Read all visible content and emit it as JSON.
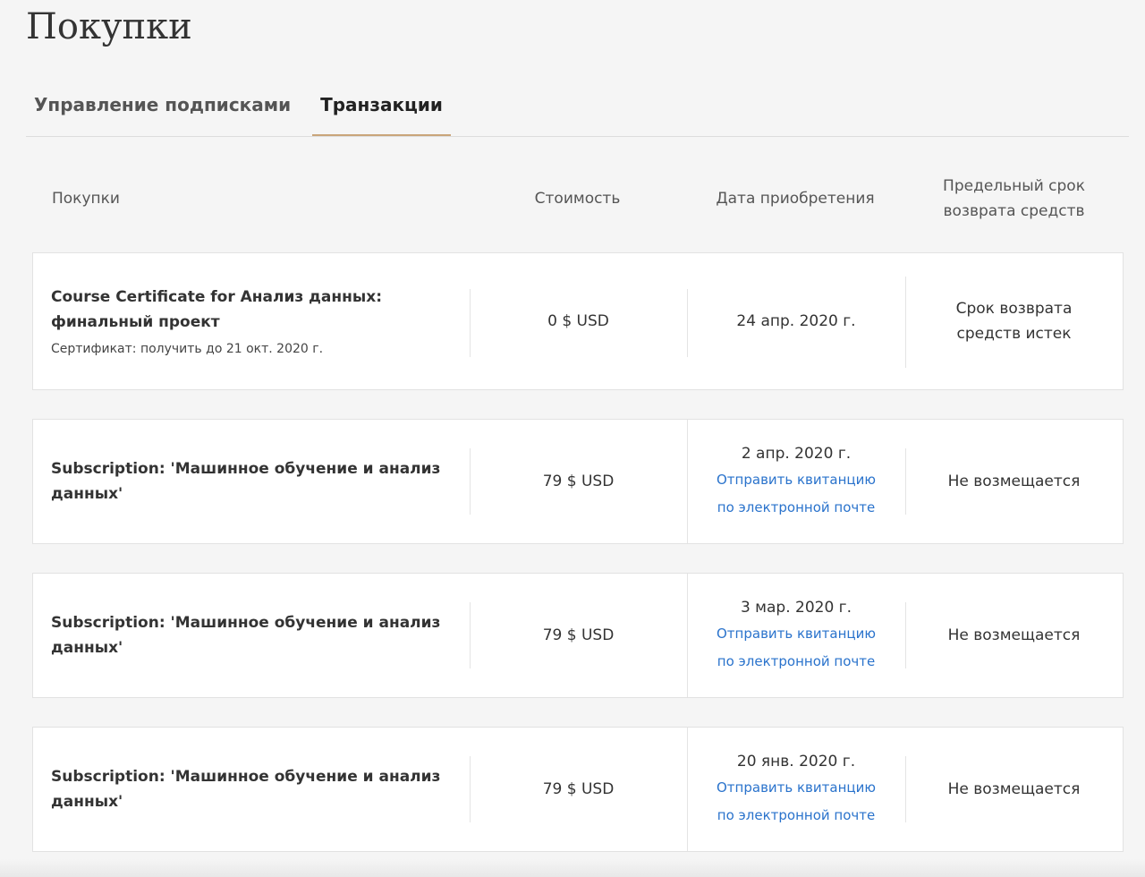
{
  "page": {
    "title": "Покупки"
  },
  "tabs": [
    {
      "label": "Управление подписками",
      "active": false
    },
    {
      "label": "Транзакции",
      "active": true
    }
  ],
  "columns": {
    "purchase": "Покупки",
    "cost": "Стоимость",
    "date": "Дата приобретения",
    "refund": "Предельный срок возврата средств"
  },
  "rows": [
    {
      "name": "Course Certificate for Анализ данных: финальный проект",
      "sub": "Сертификат: получить до 21 окт. 2020 г.",
      "cost": "0 $ USD",
      "date": "24 апр. 2020 г.",
      "receipt_link": "",
      "refund": "Срок возврата средств истек"
    },
    {
      "name": "Subscription: 'Машинное обучение и анализ данных'",
      "sub": "",
      "cost": "79 $ USD",
      "date": "2 апр. 2020 г.",
      "receipt_link": "Отправить квитанцию по электронной почте",
      "refund": "Не возмещается"
    },
    {
      "name": "Subscription: 'Машинное обучение и анализ данных'",
      "sub": "",
      "cost": "79 $ USD",
      "date": "3 мар. 2020 г.",
      "receipt_link": "Отправить квитанцию по электронной почте",
      "refund": "Не возмещается"
    },
    {
      "name": "Subscription: 'Машинное обучение и анализ данных'",
      "sub": "",
      "cost": "79 $ USD",
      "date": "20 янв. 2020 г.",
      "receipt_link": "Отправить квитанцию по электронной почте",
      "refund": "Не возмещается"
    }
  ],
  "colors": {
    "background": "#f5f5f5",
    "link": "#2a73cc",
    "tab_underline": "#c9a57a"
  }
}
